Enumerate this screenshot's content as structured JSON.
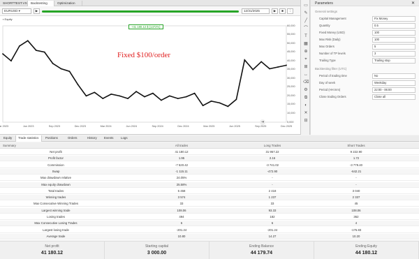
{
  "window_tabs": [
    "SHORTTEST.VS",
    "Backtesting",
    "Optimization"
  ],
  "toolbar": {
    "symbol": "EURUSD",
    "date": "12/31/2025"
  },
  "chart": {
    "badge": "+41 180.12 $ (1372%)",
    "legend": "Equity",
    "annotation": "Fixed $100/order",
    "y_ticks": [
      "60,000",
      "55,000",
      "50,000",
      "45,000",
      "40,000",
      "35,000",
      "30,000",
      "25,000",
      "20,000",
      "15,000",
      "10,000",
      "5,000"
    ],
    "x_ticks": [
      "Mar 2023",
      "Jun 2023",
      "Sep 2023",
      "Dec 2023",
      "Mar 2024",
      "Jun 2024",
      "Sep 2024",
      "Dec 2024",
      "Mar 2025",
      "Jun 2025",
      "Sep 2025",
      "Dec 2025"
    ],
    "accent": "#27a527",
    "line_color": "#111111"
  },
  "chart_data": {
    "type": "line",
    "title": "",
    "xlabel": "",
    "ylabel": "",
    "ylim": [
      5000,
      60000
    ],
    "x": [
      "2023-02",
      "2023-03",
      "2023-04",
      "2023-05",
      "2023-06",
      "2023-07",
      "2023-08",
      "2023-09",
      "2023-10",
      "2023-11",
      "2023-12",
      "2024-01",
      "2024-02",
      "2024-03",
      "2024-04",
      "2024-05",
      "2024-06",
      "2024-07",
      "2024-08",
      "2024-09",
      "2024-10",
      "2024-11",
      "2024-12",
      "2025-01",
      "2025-02",
      "2025-03",
      "2025-04",
      "2025-05",
      "2025-06",
      "2025-07",
      "2025-08",
      "2025-09",
      "2025-10",
      "2025-11",
      "2025-12"
    ],
    "series": [
      {
        "values": [
          44000,
          40000,
          48500,
          51500,
          46000,
          45000,
          38500,
          35500,
          34000,
          26500,
          20000,
          22000,
          18500,
          21000,
          20000,
          18500,
          22500,
          19500,
          21500,
          17500,
          20000,
          18500,
          19500,
          21500,
          14500,
          17000,
          16000,
          14000,
          18000,
          40500,
          35000,
          39500,
          35500,
          36500,
          37500
        ]
      }
    ]
  },
  "tools": [
    "▭",
    "✎",
    "╱",
    "⌒",
    "T",
    "▦",
    "⊕",
    "⌖",
    "⊞",
    "↔",
    "⌫",
    "⚙",
    "⧉",
    "◐",
    "✕",
    "⊟"
  ],
  "params": {
    "title": "Parameters",
    "section1": "General settings",
    "rows1": [
      {
        "label": "Capital Management",
        "value": "Fix Money"
      },
      {
        "label": "Quantity",
        "value": "0.5"
      },
      {
        "label": "Fixed Money (USD)",
        "value": "100"
      },
      {
        "label": "Max Risk (Daily)",
        "value": "100"
      },
      {
        "label": "Max Orders",
        "value": "5"
      },
      {
        "label": "Number of TP levels",
        "value": "3"
      },
      {
        "label": "Trailing Type",
        "value": "Trailing stop"
      }
    ],
    "section2": "Backtesting filter (UTC)",
    "rows2": [
      {
        "label": "Period of trading time",
        "value": "No"
      },
      {
        "label": "Day of week",
        "value": "Weekday"
      },
      {
        "label": "Period (HH:mm)",
        "value": "22:00 - 06:00"
      },
      {
        "label": "Close trading Orders",
        "value": "Close all"
      }
    ]
  },
  "bottom_tabs": [
    "Equity",
    "Trade statistics",
    "Positions",
    "Orders",
    "History",
    "Events",
    "Logs"
  ],
  "table": {
    "corner": "Summary",
    "headers": [
      "All trades",
      "Long Trades",
      "Short Trades"
    ],
    "rows": [
      {
        "label": "Net profit",
        "all": "41 180.12",
        "long": "31 957.22",
        "short": "9 222.90"
      },
      {
        "label": "Profit factor",
        "all": "1.95",
        "long": "2.16",
        "short": "1.72"
      },
      {
        "label": "Commission",
        "all": "-7 520.42",
        "long": "-3 741.02",
        "short": "-3 779.40"
      },
      {
        "label": "Swap",
        "all": "-1 115.11",
        "long": "-472.90",
        "short": "-642.21"
      },
      {
        "label": "Max drawdown relative",
        "all": "24.05%",
        "long": "-",
        "short": "-"
      },
      {
        "label": "Max equity drawdown",
        "all": "25.58%",
        "long": "-",
        "short": "-"
      },
      {
        "label": "Total trades",
        "all": "5 458",
        "long": "2 418",
        "short": "3 040"
      },
      {
        "label": "Winning trades",
        "all": "3 574",
        "long": "1 237",
        "short": "2 337"
      },
      {
        "label": "Max Consecutive Winning Trades",
        "all": "33",
        "long": "33",
        "short": "45"
      },
      {
        "label": "Largest winning trade",
        "all": "108.06",
        "long": "93.33",
        "short": "108.06"
      },
      {
        "label": "Losing trades",
        "all": "494",
        "long": "182",
        "short": "362"
      },
      {
        "label": "Max Consecutive Losing Trades",
        "all": "6",
        "long": "6",
        "short": "4"
      },
      {
        "label": "Largest losing trade",
        "all": "-201.24",
        "long": "-201.24",
        "short": "-176.83"
      },
      {
        "label": "Average trade",
        "all": "10.80",
        "long": "14.27",
        "short": "10.20"
      }
    ]
  },
  "cards": [
    {
      "label": "Net profit",
      "value": "41 180.12"
    },
    {
      "label": "Starting capital",
      "value": "3 000.00"
    },
    {
      "label": "Ending Balance",
      "value": "44 179.74"
    },
    {
      "label": "Ending Equity",
      "value": "44 180.12"
    }
  ]
}
